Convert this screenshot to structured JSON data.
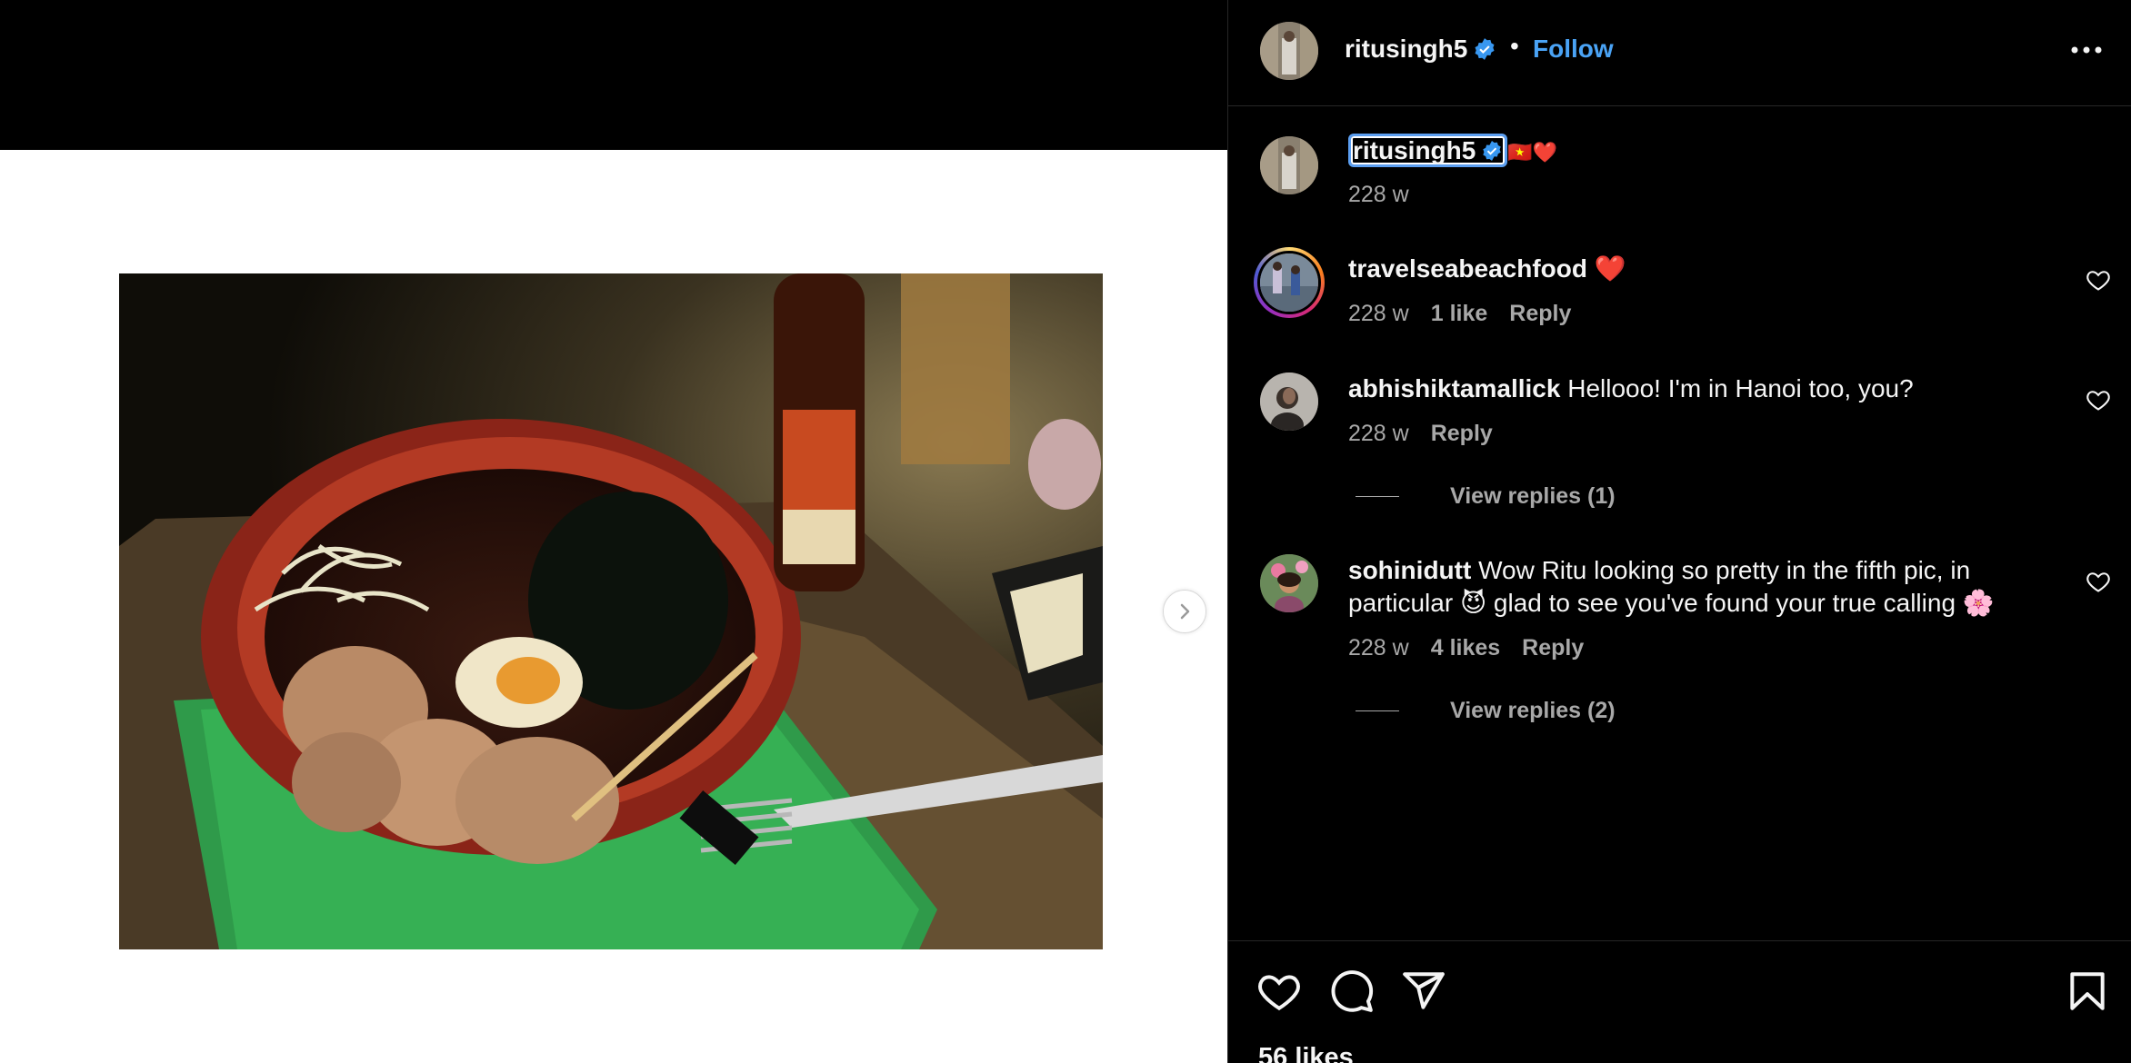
{
  "header": {
    "username": "ritusingh5",
    "separator": "•",
    "follow_label": "Follow"
  },
  "caption": {
    "username": "ritusingh5",
    "text": "🇻🇳❤️",
    "time": "228 w"
  },
  "comments": [
    {
      "username": "travelseabeachfood",
      "text": " ❤️",
      "time": "228 w",
      "likes": "1 like",
      "reply_label": "Reply"
    },
    {
      "username": "abhishiktamallick",
      "text": " Hellooo! I'm in Hanoi too, you?",
      "time": "228 w",
      "reply_label": "Reply",
      "view_replies": "View replies (1)"
    },
    {
      "username": "sohinidutt",
      "text": " Wow Ritu looking so pretty in the fifth pic, in particular 😈 glad to see you've found your true calling 🌸",
      "time": "228 w",
      "likes": "4 likes",
      "reply_label": "Reply",
      "view_replies": "View replies (2)"
    }
  ],
  "footer": {
    "likes": "56 likes"
  },
  "icons": {
    "verified": "verified-badge-icon",
    "more": "more-options-icon",
    "next": "chevron-right-icon",
    "heart": "heart-icon",
    "comment": "comment-icon",
    "share": "share-icon",
    "bookmark": "bookmark-icon"
  },
  "colors": {
    "accent": "#4aa3f5",
    "background": "#000000",
    "muted_text": "#a8a8a8"
  }
}
